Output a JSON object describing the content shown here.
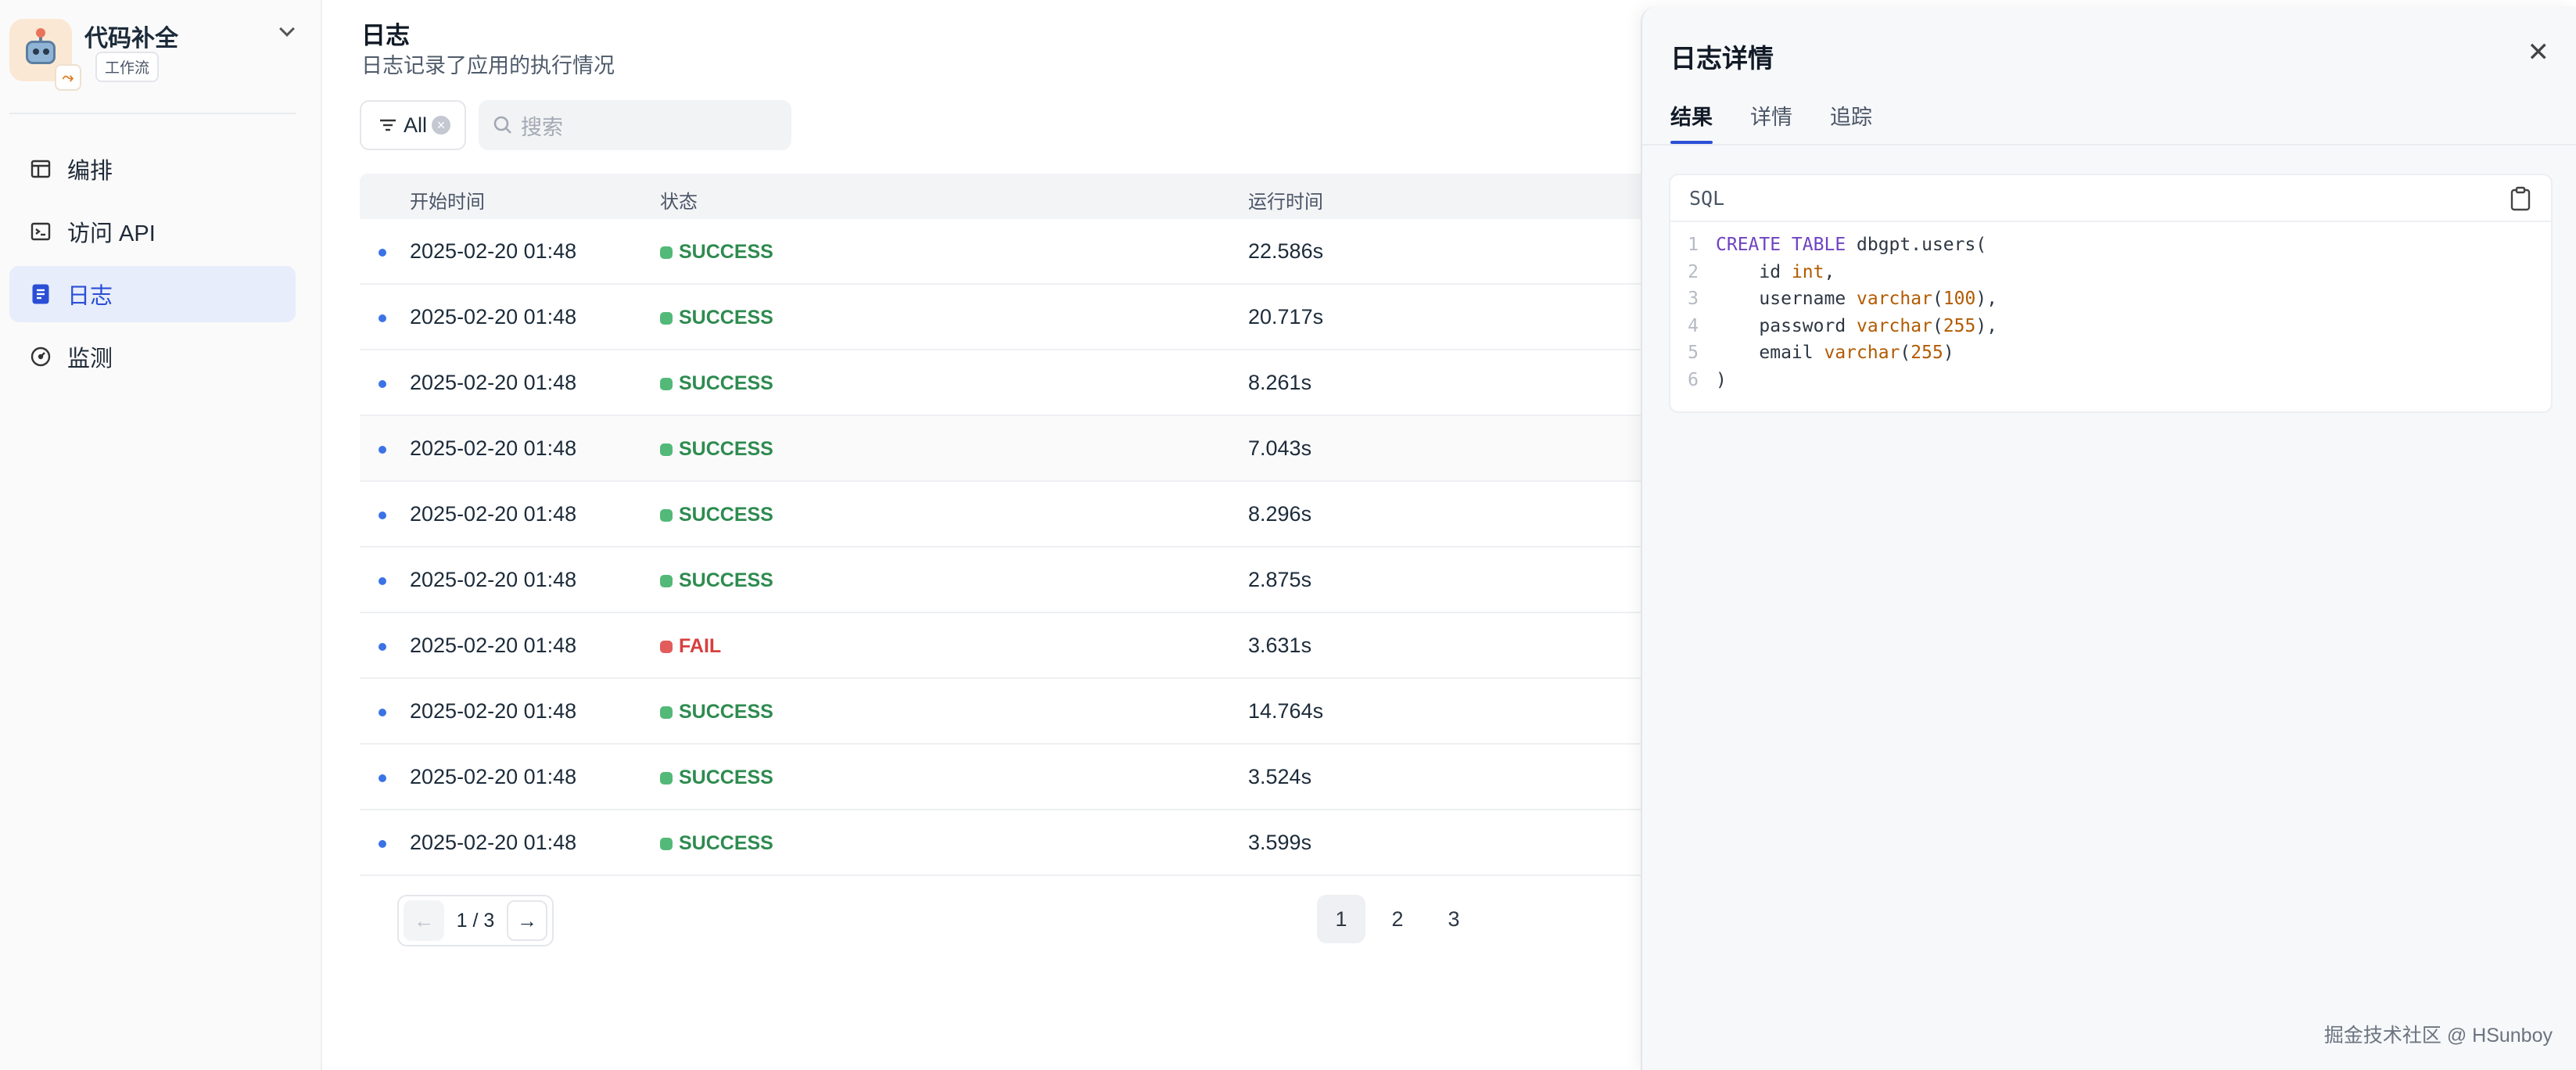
{
  "app": {
    "name": "代码补全",
    "tag": "工作流"
  },
  "sidebar": {
    "items": [
      {
        "label": "编排",
        "icon": "layout-icon"
      },
      {
        "label": "访问 API",
        "icon": "terminal-icon"
      },
      {
        "label": "日志",
        "icon": "log-icon",
        "active": true
      },
      {
        "label": "监测",
        "icon": "gauge-icon"
      }
    ]
  },
  "page": {
    "title": "日志",
    "subtitle": "日志记录了应用的执行情况"
  },
  "filter": {
    "label": "All"
  },
  "search": {
    "placeholder": "搜索"
  },
  "table": {
    "columns": [
      "开始时间",
      "状态",
      "运行时间"
    ],
    "rows": [
      {
        "time": "2025-02-20 01:48",
        "status": "SUCCESS",
        "duration": "22.586s"
      },
      {
        "time": "2025-02-20 01:48",
        "status": "SUCCESS",
        "duration": "20.717s"
      },
      {
        "time": "2025-02-20 01:48",
        "status": "SUCCESS",
        "duration": "8.261s"
      },
      {
        "time": "2025-02-20 01:48",
        "status": "SUCCESS",
        "duration": "7.043s"
      },
      {
        "time": "2025-02-20 01:48",
        "status": "SUCCESS",
        "duration": "8.296s"
      },
      {
        "time": "2025-02-20 01:48",
        "status": "SUCCESS",
        "duration": "2.875s"
      },
      {
        "time": "2025-02-20 01:48",
        "status": "FAIL",
        "duration": "3.631s"
      },
      {
        "time": "2025-02-20 01:48",
        "status": "SUCCESS",
        "duration": "14.764s"
      },
      {
        "time": "2025-02-20 01:48",
        "status": "SUCCESS",
        "duration": "3.524s"
      },
      {
        "time": "2025-02-20 01:48",
        "status": "SUCCESS",
        "duration": "3.599s"
      }
    ]
  },
  "pagination": {
    "info": "1 / 3",
    "pages": [
      "1",
      "2",
      "3"
    ],
    "current": "1"
  },
  "drawer": {
    "title": "日志详情",
    "tabs": [
      "结果",
      "详情",
      "追踪"
    ],
    "active_tab": "结果",
    "code_lang": "SQL",
    "code_lines": [
      {
        "n": "1",
        "parts": [
          [
            "kw",
            "CREATE TABLE"
          ],
          [
            "tx",
            " dbgpt.users("
          ]
        ]
      },
      {
        "n": "2",
        "parts": [
          [
            "tx",
            "    id "
          ],
          [
            "ty",
            "int"
          ],
          [
            "tx",
            ","
          ]
        ]
      },
      {
        "n": "3",
        "parts": [
          [
            "tx",
            "    username "
          ],
          [
            "ty",
            "varchar"
          ],
          [
            "tx",
            "("
          ],
          [
            "nm",
            "100"
          ],
          [
            "tx",
            "),"
          ]
        ]
      },
      {
        "n": "4",
        "parts": [
          [
            "tx",
            "    password "
          ],
          [
            "ty",
            "varchar"
          ],
          [
            "tx",
            "("
          ],
          [
            "nm",
            "255"
          ],
          [
            "tx",
            "),"
          ]
        ]
      },
      {
        "n": "5",
        "parts": [
          [
            "tx",
            "    email "
          ],
          [
            "ty",
            "varchar"
          ],
          [
            "tx",
            "("
          ],
          [
            "nm",
            "255"
          ],
          [
            "tx",
            ")"
          ]
        ]
      },
      {
        "n": "6",
        "parts": [
          [
            "tx",
            ")"
          ]
        ]
      }
    ]
  },
  "watermark": "掘金技术社区 @ HSunboy",
  "colors": {
    "accent": "#2a4fd6",
    "success": "#2e8b4f",
    "fail": "#d64040"
  }
}
